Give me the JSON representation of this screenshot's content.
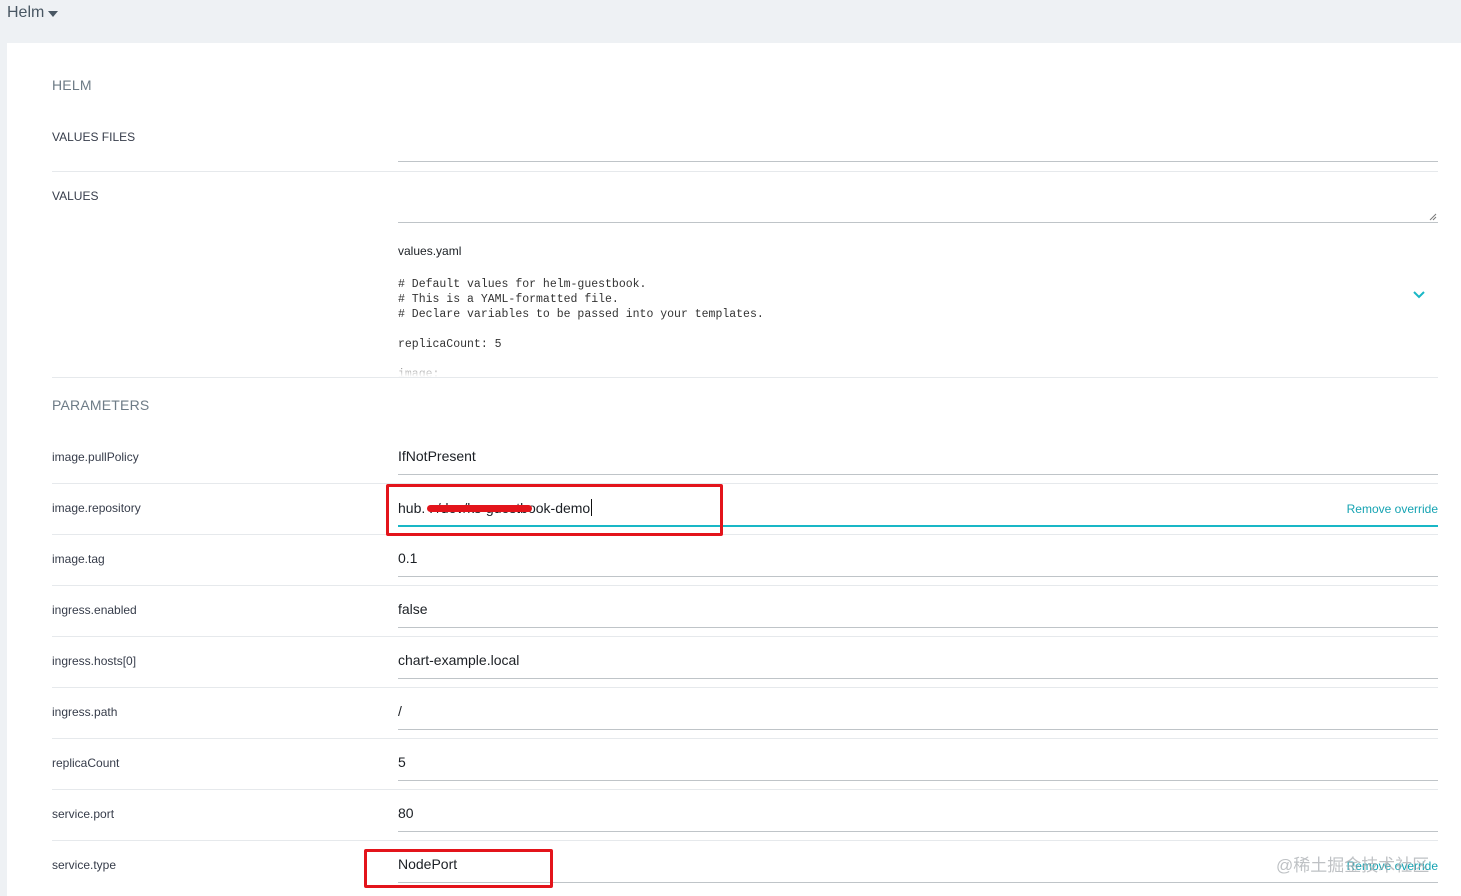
{
  "topbar": {
    "dropdown_label": "Helm"
  },
  "helm": {
    "section_title": "HELM",
    "values_files_label": "VALUES FILES",
    "values_label": "VALUES",
    "values_yaml_filename": "values.yaml",
    "values_yaml_lines": [
      "# Default values for helm-guestbook.",
      "# This is a YAML-formatted file.",
      "# Declare variables to be passed into your templates.",
      "",
      "replicaCount: 5",
      "",
      "image:"
    ]
  },
  "parameters": {
    "section_title": "PARAMETERS",
    "remove_override_label": "Remove override",
    "rows": [
      {
        "name": "image.pullPolicy",
        "value": "IfNotPresent"
      },
      {
        "name": "image.repository",
        "value": "hub.            .   /dev/ks-guestbook-demo"
      },
      {
        "name": "image.tag",
        "value": "0.1"
      },
      {
        "name": "ingress.enabled",
        "value": "false"
      },
      {
        "name": "ingress.hosts[0]",
        "value": "chart-example.local"
      },
      {
        "name": "ingress.path",
        "value": "/"
      },
      {
        "name": "replicaCount",
        "value": "5"
      },
      {
        "name": "service.port",
        "value": "80"
      },
      {
        "name": "service.type",
        "value": "NodePort"
      }
    ]
  },
  "watermark": "@稀土掘金技术社区",
  "colors": {
    "accent": "#19b7c6",
    "annotation_red": "#e3141b"
  }
}
